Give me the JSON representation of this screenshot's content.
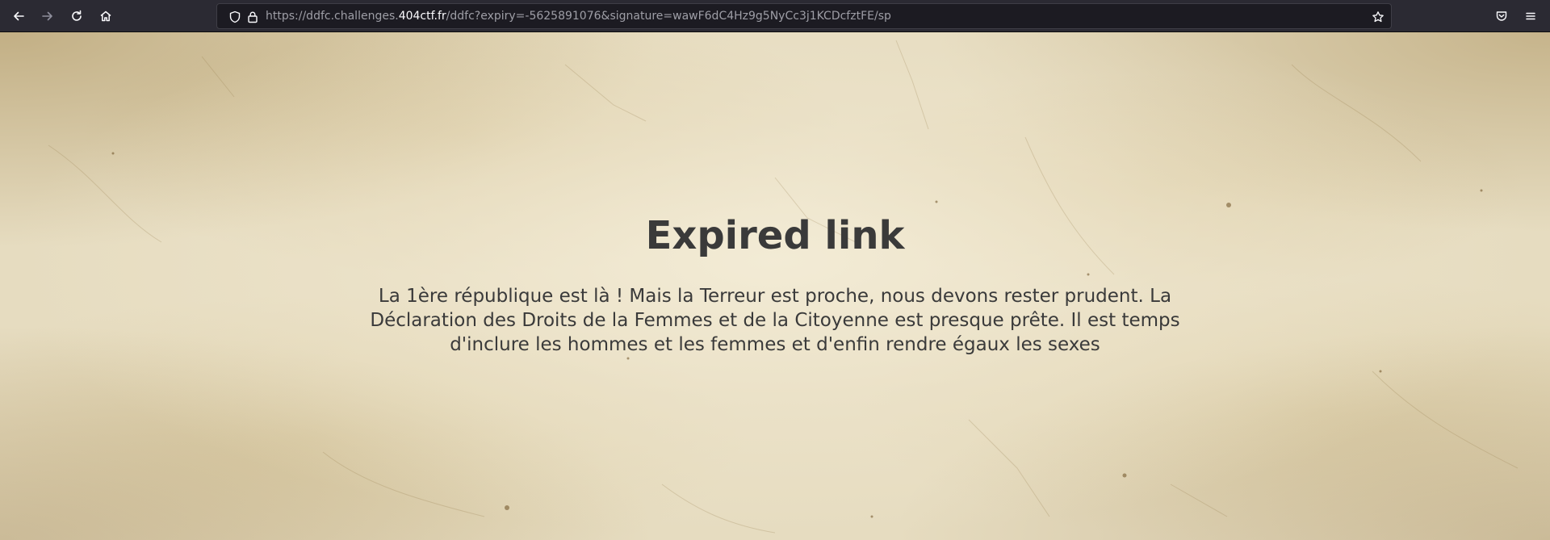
{
  "browser": {
    "nav": {
      "back_icon": "arrow-left-icon",
      "forward_icon": "arrow-right-icon",
      "reload_icon": "reload-icon",
      "home_icon": "home-icon"
    },
    "urlbar": {
      "tracking_icon": "shield-icon",
      "lock_icon": "lock-icon",
      "url_prefix": "https://ddfc.challenges.",
      "url_host": "404ctf.fr",
      "url_path": "/ddfc?expiry=-5625891076&signature=wawF6dC4Hz9g5NyCc3j1KCDcfztFE/sp",
      "bookmark_icon": "star-icon"
    },
    "right_icons": {
      "pocket_icon": "pocket-icon",
      "menu_icon": "hamburger-menu-icon"
    }
  },
  "page": {
    "title": "Expired link",
    "message": "La 1ère république est là ! Mais la Terreur est proche, nous devons rester prudent. La Déclaration des Droits de la Femmes et de la Citoyenne est presque prête. Il est temps d'inclure les hommes et les femmes et d'enfin rendre égaux les sexes"
  },
  "colors": {
    "toolbar_bg": "#2b2a33",
    "urlbar_bg": "#1c1b22",
    "parchment": "#e6dcc0",
    "text": "#3a3a3a"
  }
}
